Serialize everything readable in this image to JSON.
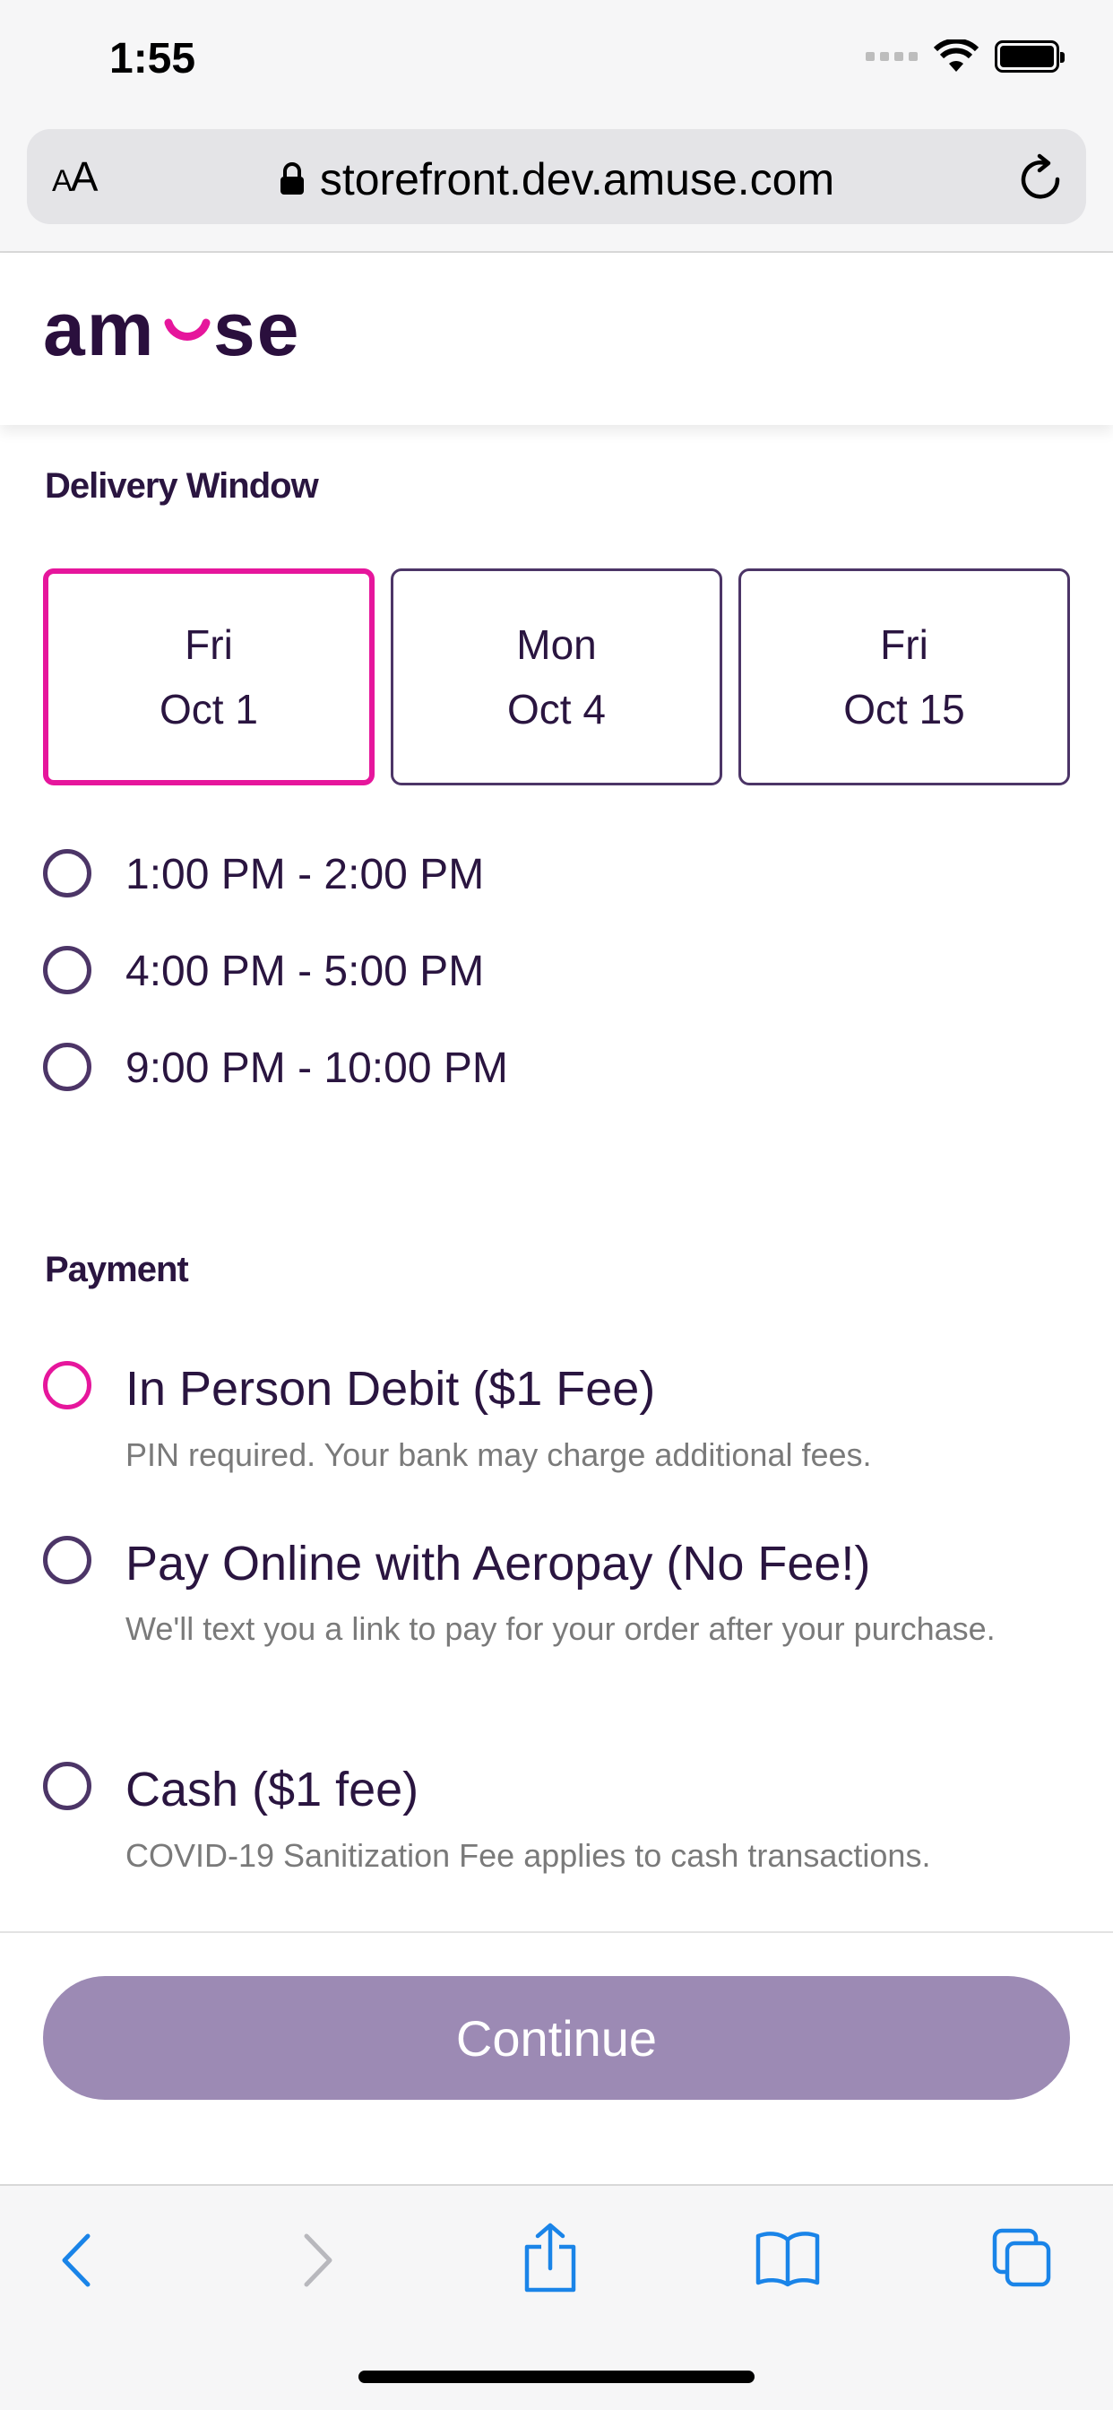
{
  "status_bar": {
    "time": "1:55"
  },
  "browser": {
    "text_size_label_small": "A",
    "text_size_label_large": "A",
    "url": "storefront.dev.amuse.com"
  },
  "site": {
    "logo_text": "amuse",
    "brand_color": "#2a0f3d",
    "accent_color": "#e6169c"
  },
  "delivery": {
    "title": "Delivery Window",
    "dates": [
      {
        "day": "Fri",
        "date": "Oct 1",
        "selected": true
      },
      {
        "day": "Mon",
        "date": "Oct 4",
        "selected": false
      },
      {
        "day": "Fri",
        "date": "Oct 15",
        "selected": false
      }
    ],
    "times": [
      "1:00 PM - 2:00 PM",
      "4:00 PM - 5:00 PM",
      "9:00 PM - 10:00 PM"
    ]
  },
  "payment": {
    "title": "Payment",
    "options": [
      {
        "title": "In Person Debit ($1 Fee)",
        "desc": "PIN required. Your bank may charge additional fees."
      },
      {
        "title": "Pay Online with Aeropay (No Fee!)",
        "desc": "We'll text you a link to pay for your order after your purchase."
      },
      {
        "title": "Cash ($1 fee)",
        "desc": "COVID-19 Sanitization Fee applies to cash transactions."
      }
    ]
  },
  "continue_label": "Continue",
  "toolbar": {
    "icons": [
      "back-icon",
      "forward-icon",
      "share-icon",
      "bookmarks-icon",
      "tabs-icon"
    ]
  }
}
